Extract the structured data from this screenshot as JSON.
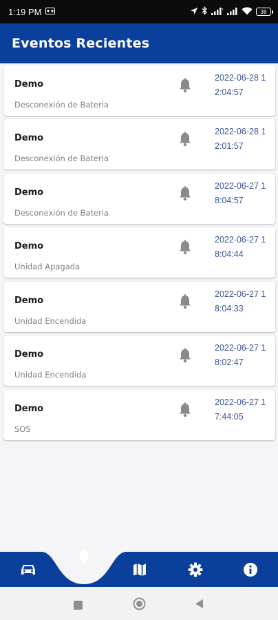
{
  "status_bar": {
    "time": "1:19 PM",
    "battery": "38"
  },
  "app_bar": {
    "title": "Eventos Recientes"
  },
  "events": [
    {
      "title": "Demo",
      "subtitle": "Desconexión de Bateria",
      "timestamp": "2022-06-28 12:04:57"
    },
    {
      "title": "Demo",
      "subtitle": "Desconexión de Bateria",
      "timestamp": "2022-06-28 12:01:57"
    },
    {
      "title": "Demo",
      "subtitle": "Desconexión de Bateria",
      "timestamp": "2022-06-27 18:04:57"
    },
    {
      "title": "Demo",
      "subtitle": "Unidad Apagada",
      "timestamp": "2022-06-27 18:04:44"
    },
    {
      "title": "Demo",
      "subtitle": "Unidad Encendida",
      "timestamp": "2022-06-27 18:04:33"
    },
    {
      "title": "Demo",
      "subtitle": "Unidad Encendida",
      "timestamp": "2022-06-27 18:02:47"
    },
    {
      "title": "Demo",
      "subtitle": "SOS",
      "timestamp": "2022-06-27 17:44:05"
    }
  ],
  "bottom_nav": {
    "items": [
      {
        "icon": "car-icon"
      },
      {
        "icon": "bell-icon",
        "active": true
      },
      {
        "icon": "map-icon"
      },
      {
        "icon": "gear-icon"
      },
      {
        "icon": "info-icon"
      }
    ]
  },
  "colors": {
    "primary": "#0a3f9b",
    "timestamp": "#3c5597",
    "bell": "#8a8a8a",
    "background": "#f5f5f7"
  }
}
